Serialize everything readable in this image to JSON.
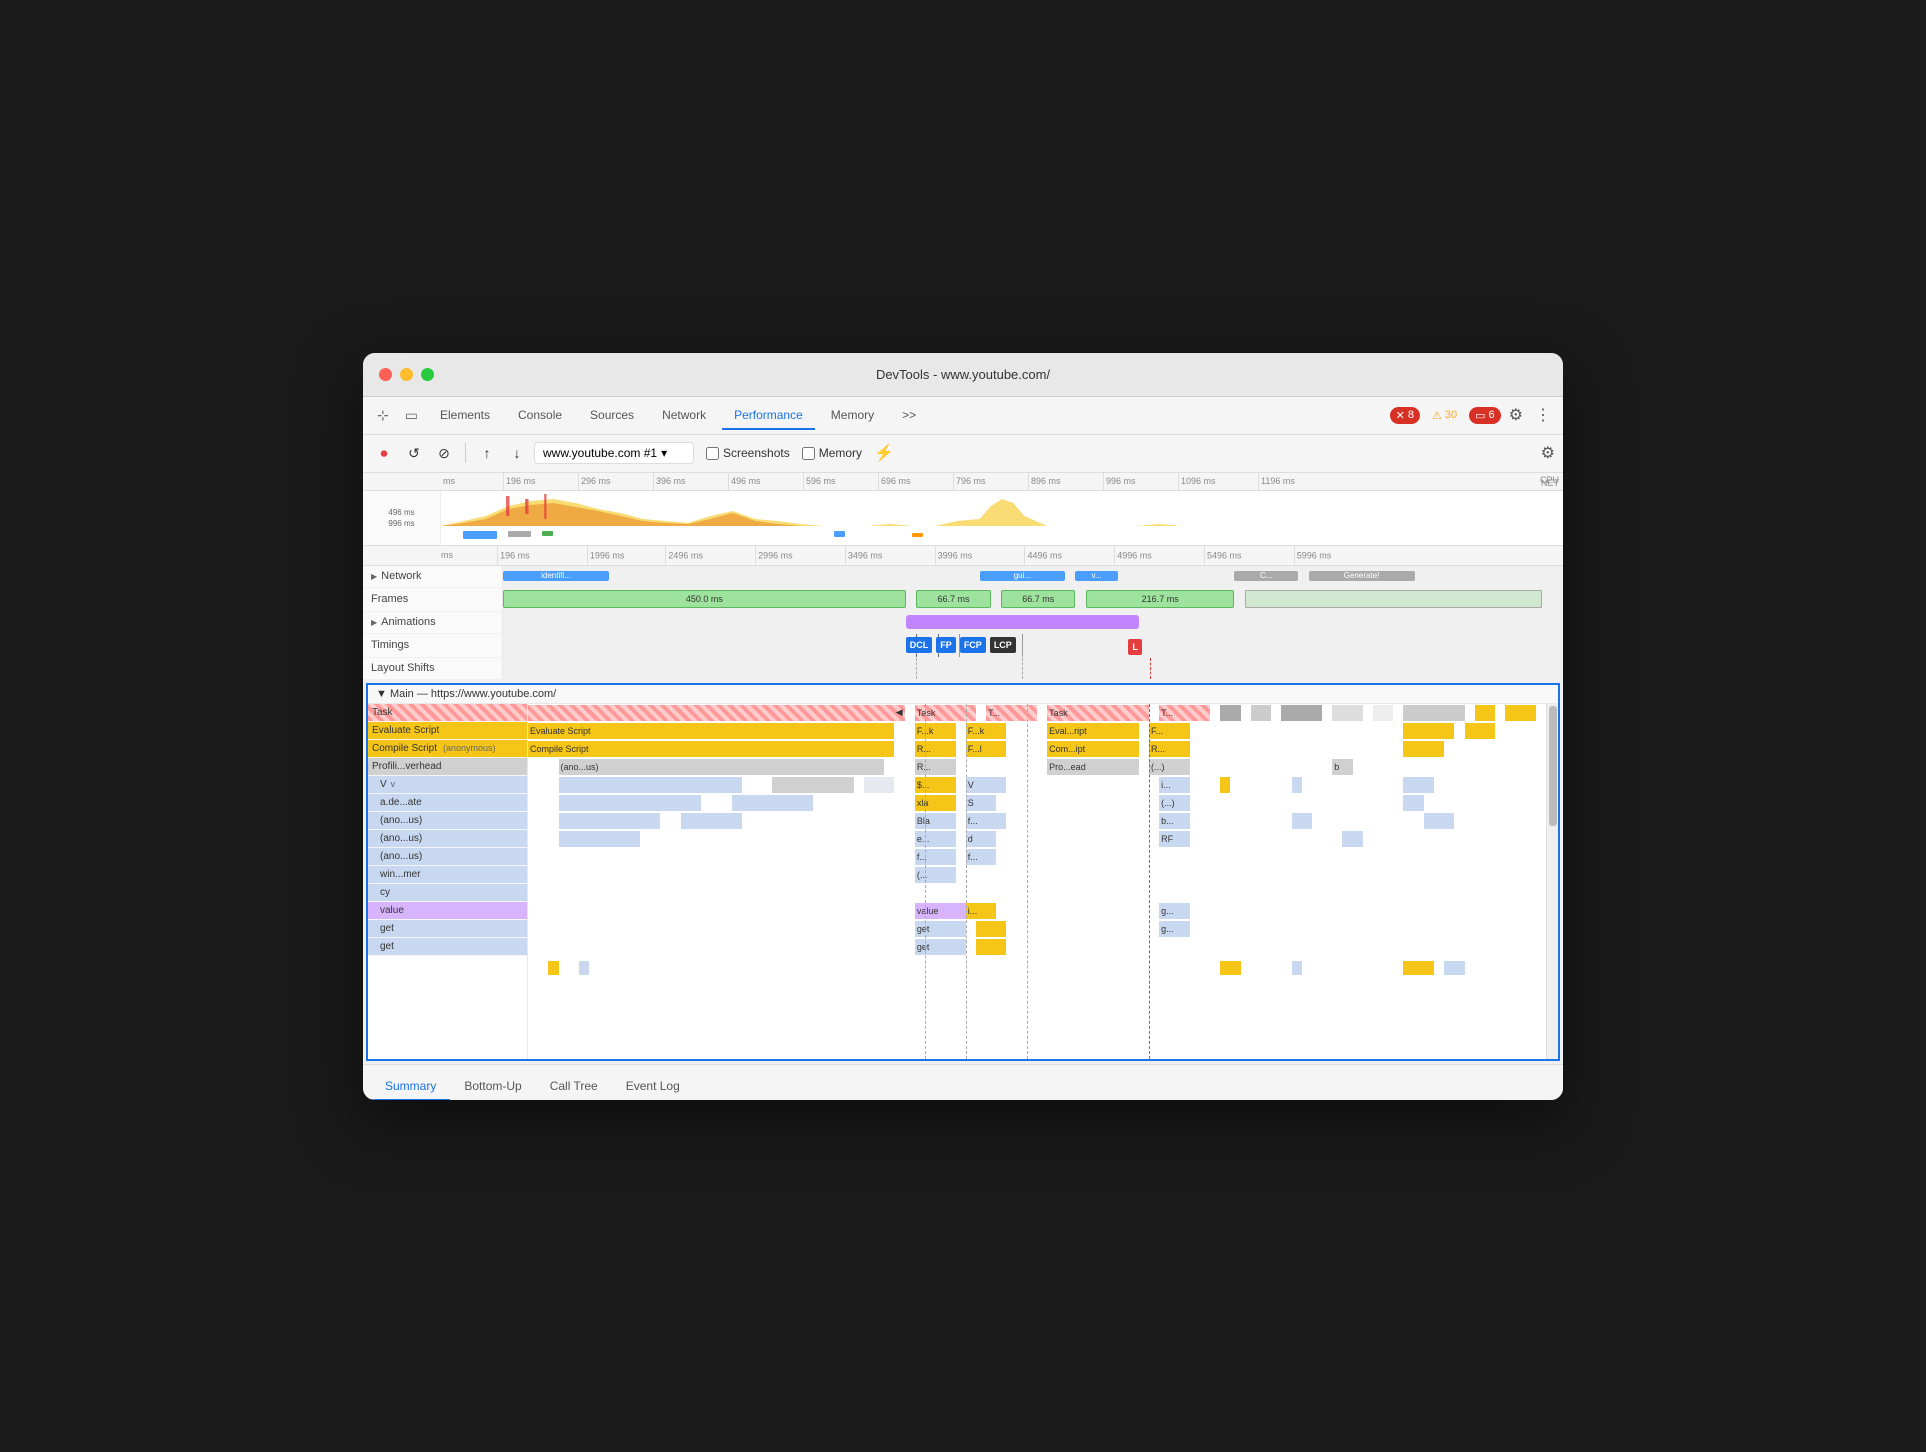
{
  "window": {
    "title": "DevTools - www.youtube.com/"
  },
  "tabs": {
    "items": [
      {
        "label": "Elements",
        "active": false
      },
      {
        "label": "Console",
        "active": false
      },
      {
        "label": "Sources",
        "active": false
      },
      {
        "label": "Network",
        "active": false
      },
      {
        "label": "Performance",
        "active": true
      },
      {
        "label": "Memory",
        "active": false
      }
    ],
    "overflow": ">>",
    "error_badge": "8",
    "warning_badge": "30",
    "info_badge": "6"
  },
  "toolbar": {
    "record_label": "⏺",
    "reload_label": "↺",
    "clear_label": "⊘",
    "upload_label": "↑",
    "download_label": "↓",
    "url_selector": "www.youtube.com #1",
    "screenshots_label": "Screenshots",
    "memory_label": "Memory",
    "network_throttle_icon": "⚡",
    "settings_icon": "⚙"
  },
  "ruler": {
    "ticks": [
      "ms",
      "196 ms",
      "296 ms",
      "396 ms",
      "496 ms",
      "596 ms",
      "696 ms",
      "796 ms",
      "896 ms",
      "996 ms",
      "1096 ms",
      "1196 ms"
    ]
  },
  "ruler2": {
    "ticks": [
      "496 ms",
      "996 ms",
      "196 ms",
      "1996 ms",
      "2496 ms",
      "2996 ms",
      "3496 ms",
      "3996 ms",
      "4496 ms",
      "4996 ms",
      "5496 ms",
      "5996 ms"
    ]
  },
  "timeline_labels": {
    "cpu": "CPU",
    "net": "NET"
  },
  "tracks": {
    "network": {
      "label": "Network",
      "arrow": "▶"
    },
    "frames": {
      "label": "Frames",
      "bars": [
        {
          "text": "450.0 ms",
          "left": "14%",
          "width": "35%"
        },
        {
          "text": "66.7 ms",
          "left": "50%",
          "width": "6%"
        },
        {
          "text": "66.7 ms",
          "left": "57%",
          "width": "6%"
        },
        {
          "text": "216.7 ms",
          "left": "63%",
          "width": "10%"
        }
      ]
    },
    "animations": {
      "label": "Animations",
      "arrow": "▶"
    },
    "timings": {
      "label": "Timings",
      "badges": [
        {
          "label": "DCL",
          "class": "tb-dcl"
        },
        {
          "label": "FP",
          "class": "tb-fp"
        },
        {
          "label": "FCP",
          "class": "tb-fcp"
        },
        {
          "label": "LCP",
          "class": "tb-lcp"
        },
        {
          "label": "L",
          "class": "tb-l"
        }
      ]
    },
    "layout_shifts": {
      "label": "Layout Shifts"
    }
  },
  "main": {
    "header": "▼  Main — https://www.youtube.com/",
    "rows": [
      {
        "label": "Task",
        "indent": 0,
        "color": "c-task-hatched",
        "extra_cells": [
          {
            "text": "Task",
            "color": "c-task-hatched"
          },
          {
            "text": "T...",
            "color": "c-task-hatched"
          },
          {
            "text": "Task",
            "color": "c-task-hatched"
          },
          {
            "text": "T...",
            "color": "c-task-hatched"
          }
        ]
      },
      {
        "label": "Evaluate Script",
        "indent": 1,
        "color": "c-yellow",
        "extra_cells": [
          {
            "text": "F...k",
            "color": "c-yellow"
          },
          {
            "text": "F...k",
            "color": "c-yellow"
          },
          {
            "text": "Eval...ript",
            "color": "c-yellow"
          },
          {
            "text": "F...",
            "color": "c-yellow"
          }
        ]
      },
      {
        "label": "Compile Script",
        "indent": 1,
        "color": "c-yellow",
        "sub_label": "(anonymous)",
        "extra_cells": [
          {
            "text": "R...",
            "color": "c-yellow"
          },
          {
            "text": "F...l",
            "color": "c-yellow"
          },
          {
            "text": "Com...ipt",
            "color": "c-yellow"
          },
          {
            "text": "R...",
            "color": "c-yellow"
          }
        ]
      },
      {
        "label": "Profili...verhead",
        "indent": 1,
        "color": "c-gray-light",
        "sub_label": "(ano...us)",
        "extra_cells": [
          {
            "text": "R...",
            "color": "c-gray-light"
          },
          {
            "text": "",
            "color": "c-empty"
          },
          {
            "text": "Pro...ead",
            "color": "c-gray-light"
          },
          {
            "text": "(...)",
            "color": "c-gray-light"
          },
          {
            "text": "b",
            "color": "c-gray-light"
          }
        ]
      },
      {
        "label": "V",
        "indent": 2,
        "color": "c-blue-light",
        "sub_label": "v",
        "extra_cells": [
          {
            "text": "$...",
            "color": "c-yellow"
          },
          {
            "text": "V",
            "color": "c-blue-light"
          },
          {
            "text": "",
            "color": "c-empty"
          },
          {
            "text": "i...",
            "color": "c-blue-light"
          }
        ]
      },
      {
        "label": "a.de...ate",
        "indent": 2,
        "color": "c-blue-light",
        "extra_cells": [
          {
            "text": "xla",
            "color": "c-yellow"
          },
          {
            "text": "S",
            "color": "c-blue-light"
          },
          {
            "text": "",
            "color": "c-empty"
          },
          {
            "text": "(...)",
            "color": "c-blue-light"
          }
        ]
      },
      {
        "label": "(ano...us)",
        "indent": 2,
        "color": "c-blue-light",
        "extra_cells": [
          {
            "text": "Bla",
            "color": "c-blue-light"
          },
          {
            "text": "f...",
            "color": "c-blue-light"
          },
          {
            "text": "",
            "color": "c-empty"
          },
          {
            "text": "b...",
            "color": "c-blue-light"
          }
        ]
      },
      {
        "label": "(ano...us)",
        "indent": 2,
        "color": "c-blue-light",
        "extra_cells": [
          {
            "text": "e...",
            "color": "c-blue-light"
          },
          {
            "text": "d",
            "color": "c-blue-light"
          },
          {
            "text": "",
            "color": "c-empty"
          },
          {
            "text": "RF",
            "color": "c-blue-light"
          }
        ]
      },
      {
        "label": "(ano...us)",
        "indent": 2,
        "color": "c-blue-light",
        "extra_cells": [
          {
            "text": "f...",
            "color": "c-blue-light"
          },
          {
            "text": "f...",
            "color": "c-blue-light"
          }
        ]
      },
      {
        "label": "win...mer",
        "indent": 2,
        "color": "c-blue-light",
        "extra_cells": [
          {
            "text": "(...",
            "color": "c-blue-light"
          }
        ]
      },
      {
        "label": "cy",
        "indent": 2,
        "color": "c-blue-light",
        "extra_cells": []
      },
      {
        "label": "value",
        "indent": 2,
        "color": "c-purple-light",
        "extra_cells": [
          {
            "text": "i...",
            "color": "c-purple-light"
          },
          {
            "text": "g...",
            "color": "c-blue-light"
          }
        ]
      },
      {
        "label": "get",
        "indent": 2,
        "color": "c-blue-light",
        "extra_cells": [
          {
            "text": "g...",
            "color": "c-blue-light"
          }
        ]
      },
      {
        "label": "get",
        "indent": 2,
        "color": "c-blue-light",
        "extra_cells": []
      }
    ]
  },
  "bottom_tabs": {
    "items": [
      {
        "label": "Summary",
        "active": true
      },
      {
        "label": "Bottom-Up",
        "active": false
      },
      {
        "label": "Call Tree",
        "active": false
      },
      {
        "label": "Event Log",
        "active": false
      }
    ]
  }
}
